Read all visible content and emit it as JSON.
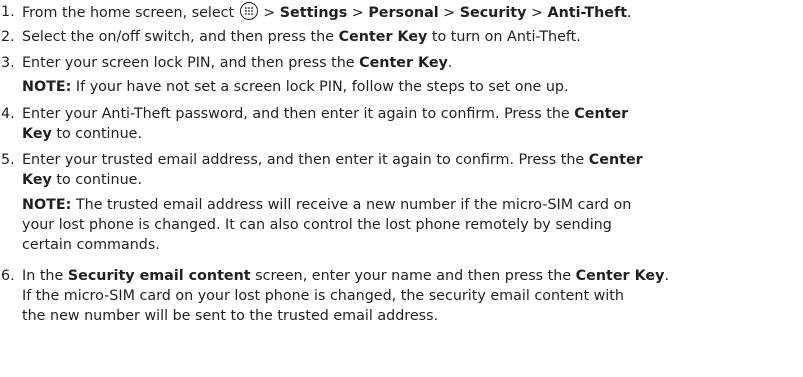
{
  "steps": [
    {
      "number": "1.",
      "lines": [
        [
          {
            "t": "From the home screen, select "
          },
          {
            "icon": "apps-icon"
          },
          {
            "t": " > "
          },
          {
            "b": "Settings"
          },
          {
            "t": " > "
          },
          {
            "b": "Personal"
          },
          {
            "t": " > "
          },
          {
            "b": "Security"
          },
          {
            "t": " > "
          },
          {
            "b": "Anti-Theft"
          },
          {
            "t": "."
          }
        ]
      ]
    },
    {
      "number": "2.",
      "lines": [
        [
          {
            "t": "Select the on/off switch, and then press the "
          },
          {
            "b": "Center Key"
          },
          {
            "t": " to turn on Anti-Theft."
          }
        ]
      ]
    },
    {
      "number": "3.",
      "lines": [
        [
          {
            "t": "Enter your screen lock PIN, and then press the "
          },
          {
            "b": "Center Key"
          },
          {
            "t": "."
          }
        ]
      ],
      "note": {
        "label": "NOTE:",
        "lines": [
          "If your have not set a screen lock PIN, follow the steps to set one up."
        ]
      }
    },
    {
      "number": "4.",
      "lines": [
        [
          {
            "t": "Enter your Anti-Theft password, and then enter it again to confirm. Press the "
          },
          {
            "b": "Center"
          }
        ],
        [
          {
            "b": "Key"
          },
          {
            "t": " to continue."
          }
        ]
      ]
    },
    {
      "number": "5.",
      "lines": [
        [
          {
            "t": "Enter your trusted email address, and then enter it again to confirm. Press the "
          },
          {
            "b": "Center"
          }
        ],
        [
          {
            "b": "Key"
          },
          {
            "t": " to continue."
          }
        ]
      ],
      "note": {
        "label": "NOTE:",
        "lines": [
          "The trusted email address will receive a new number if the micro-SIM card on",
          "your lost phone is changed. It can also control the lost phone remotely by sending",
          "certain commands."
        ]
      }
    },
    {
      "number": "6.",
      "lines": [
        [
          {
            "t": "In the "
          },
          {
            "b": "Security email content"
          },
          {
            "t": " screen, enter your name and then press the "
          },
          {
            "b": "Center Key"
          },
          {
            "t": "."
          }
        ],
        [
          {
            "t": "If the micro-SIM card on your lost phone is changed, the security email content with"
          }
        ],
        [
          {
            "t": "the new number will be sent to the trusted email address."
          }
        ]
      ]
    }
  ]
}
